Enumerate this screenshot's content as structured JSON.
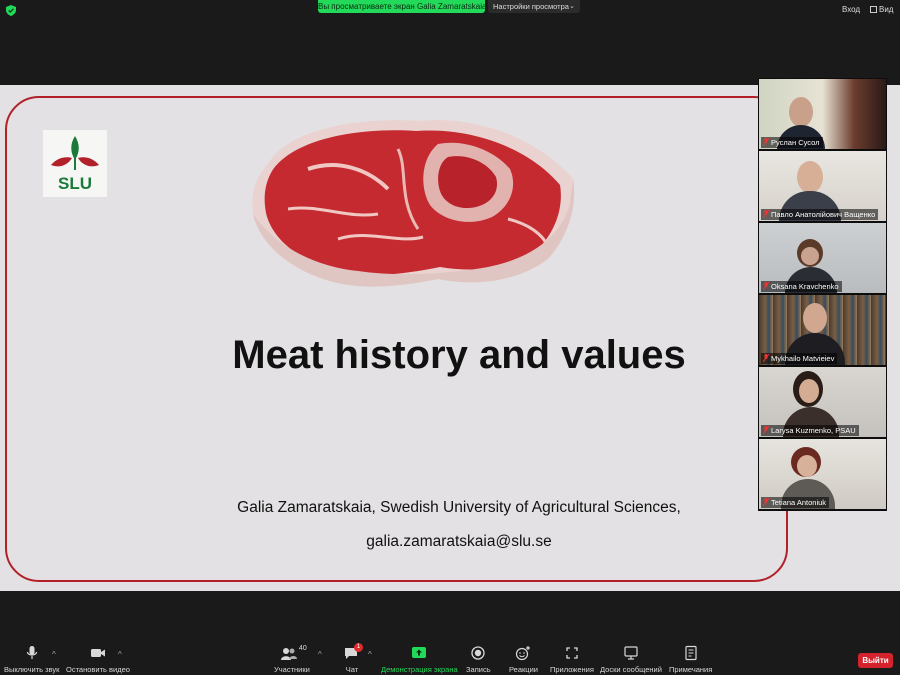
{
  "topbar": {
    "share_banner": "Вы просматриваете экран Galia Zamaratskaia",
    "view_options": "Настройки просмотра",
    "enter": "Вход",
    "view": "Вид"
  },
  "slide": {
    "logo_text": "SLU",
    "title": "Meat history and values",
    "author": "Galia Zamaratskaia, Swedish University of Agricultural Sciences,",
    "email": "galia.zamaratskaia@slu.se"
  },
  "participants": [
    {
      "name": "Руслан Сусол"
    },
    {
      "name": "Павло Анатолійович Ващенко"
    },
    {
      "name": "Oksana Kravchenko"
    },
    {
      "name": "Mykhailo Matvieiev"
    },
    {
      "name": "Larysa Kuzmenko, PSAU"
    },
    {
      "name": "Tetiana Antoniuk"
    }
  ],
  "toolbar": {
    "mute": "Выключить звук",
    "stop_video": "Остановить видео",
    "participants": "Участники",
    "participants_count": "40",
    "chat": "Чат",
    "chat_badge": "1",
    "share_screen": "Демонстрация экрана",
    "record": "Запись",
    "reactions": "Реакции",
    "apps": "Приложения",
    "whiteboards": "Доски сообщений",
    "notes": "Примечания",
    "leave": "Выйти"
  },
  "colors": {
    "share_green": "#23d959",
    "slide_border": "#b2212a",
    "slu_green": "#1b7a3a",
    "leave_red": "#d4232c"
  }
}
